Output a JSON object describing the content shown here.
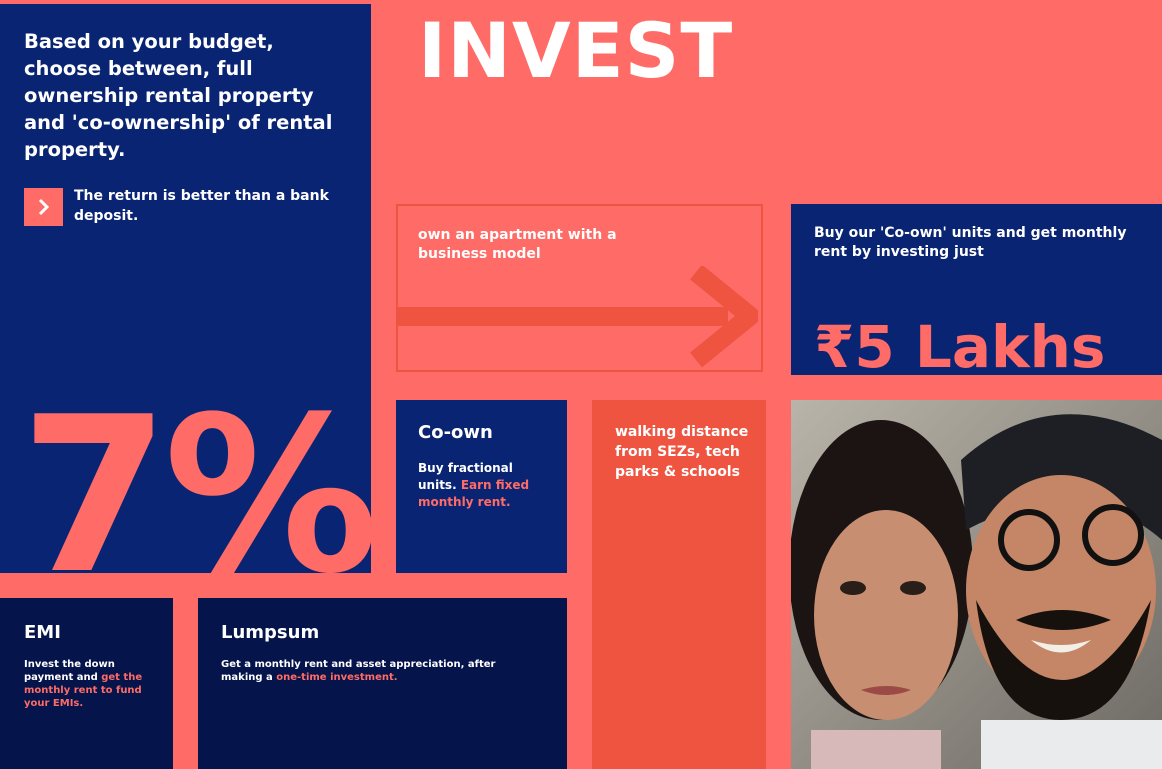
{
  "title": "INVEST",
  "intro": {
    "heading": "Based on your budget, choose between, full ownership rental property and 'co-ownership' of rental property.",
    "chevron_icon": "chevron-right-icon",
    "return_text": "The return is better than a bank deposit.",
    "percentage": "7%"
  },
  "apartment": {
    "text": "own an apartment with a business model",
    "arrow_icon": "arrow-right-icon"
  },
  "coown_buy": {
    "text": "Buy our 'Co-own' units and get monthly rent by investing just",
    "amount": "₹5 Lakhs"
  },
  "coown": {
    "heading": "Co-own",
    "text": "Buy fractional units.",
    "highlight": "Earn fixed monthly rent."
  },
  "walking": {
    "text": "walking distance from SEZs, tech parks & schools"
  },
  "emi": {
    "heading": "EMI",
    "text": "Invest the down payment and",
    "highlight": "get the monthly rent to fund your EMIs."
  },
  "lumpsum": {
    "heading": "Lumpsum",
    "text": "Get a monthly rent and asset appreciation, after making a",
    "highlight": "one-time investment."
  },
  "colors": {
    "coral": "#ff6b66",
    "navy": "#0a2474",
    "dark_navy": "#05144a",
    "orange": "#ee5440"
  }
}
